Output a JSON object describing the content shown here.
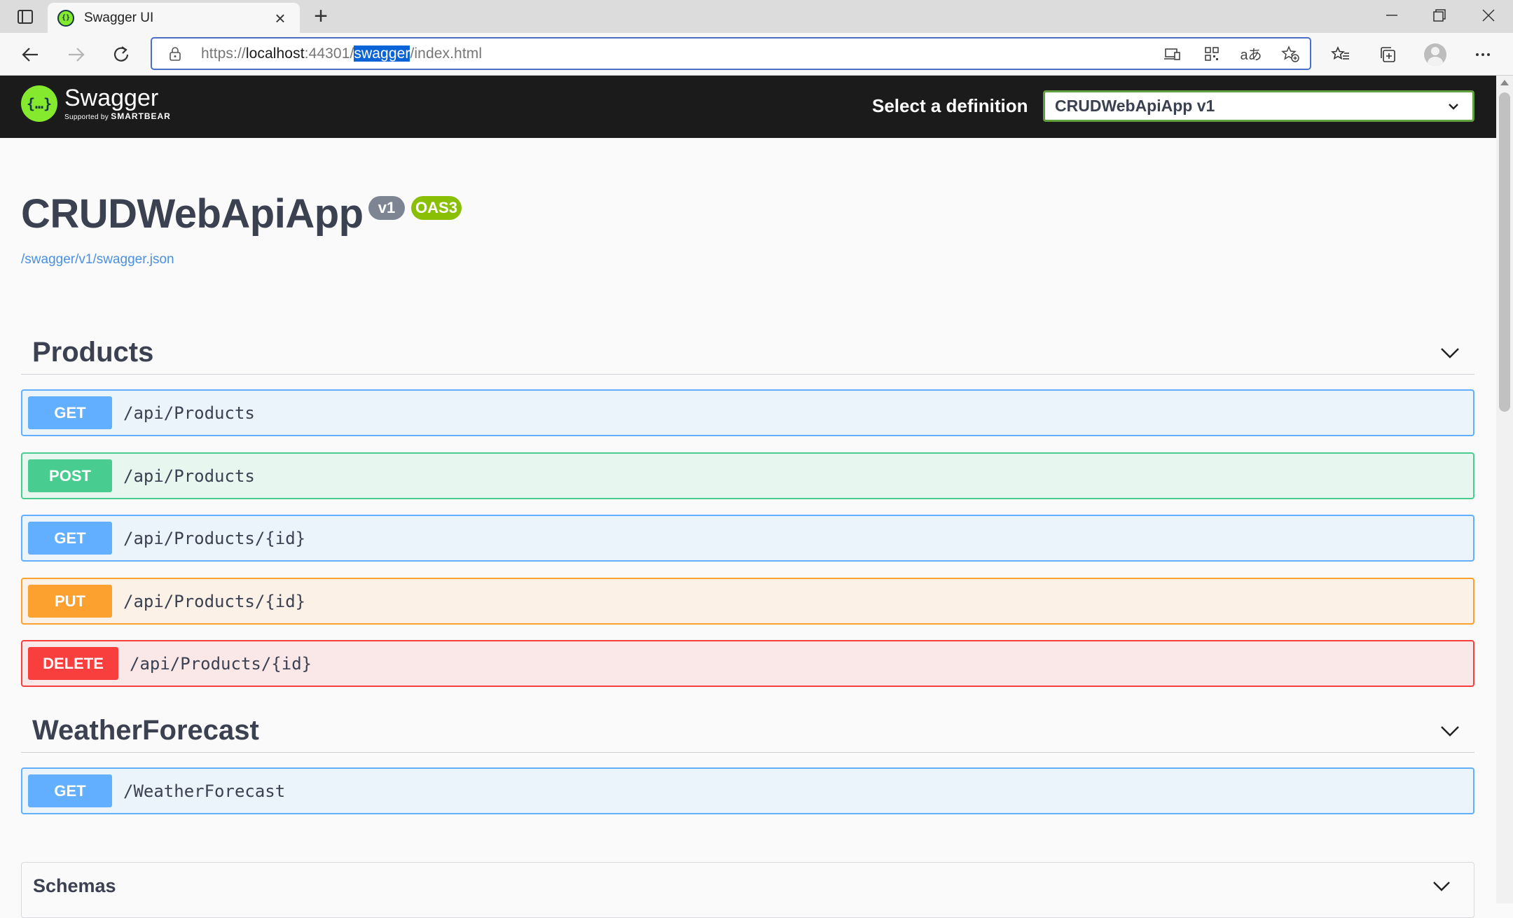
{
  "browser": {
    "tab_title": "Swagger UI",
    "url_prefix": "https://",
    "url_host": "localhost",
    "url_port_path": ":44301/",
    "url_selected": "swagger",
    "url_rest": "/index.html"
  },
  "topbar": {
    "logo_name": "Swagger",
    "logo_supported_by": "Supported by",
    "logo_brand": "SMARTBEAR",
    "definition_label": "Select a definition",
    "definition_value": "CRUDWebApiApp v1"
  },
  "info": {
    "title": "CRUDWebApiApp",
    "version_badge": "v1",
    "oas_badge": "OAS3",
    "spec_link": "/swagger/v1/swagger.json"
  },
  "tags": [
    {
      "name": "Products",
      "operations": [
        {
          "method": "GET",
          "path": "/api/Products"
        },
        {
          "method": "POST",
          "path": "/api/Products"
        },
        {
          "method": "GET",
          "path": "/api/Products/{id}"
        },
        {
          "method": "PUT",
          "path": "/api/Products/{id}"
        },
        {
          "method": "DELETE",
          "path": "/api/Products/{id}"
        }
      ]
    },
    {
      "name": "WeatherForecast",
      "operations": [
        {
          "method": "GET",
          "path": "/WeatherForecast"
        }
      ]
    }
  ],
  "schemas": {
    "title": "Schemas"
  },
  "colors": {
    "get": "#61affe",
    "post": "#49cc90",
    "put": "#fca130",
    "delete": "#f93e3e",
    "swagger_green": "#85ea2d",
    "topbar_bg": "#1b1b1b"
  }
}
